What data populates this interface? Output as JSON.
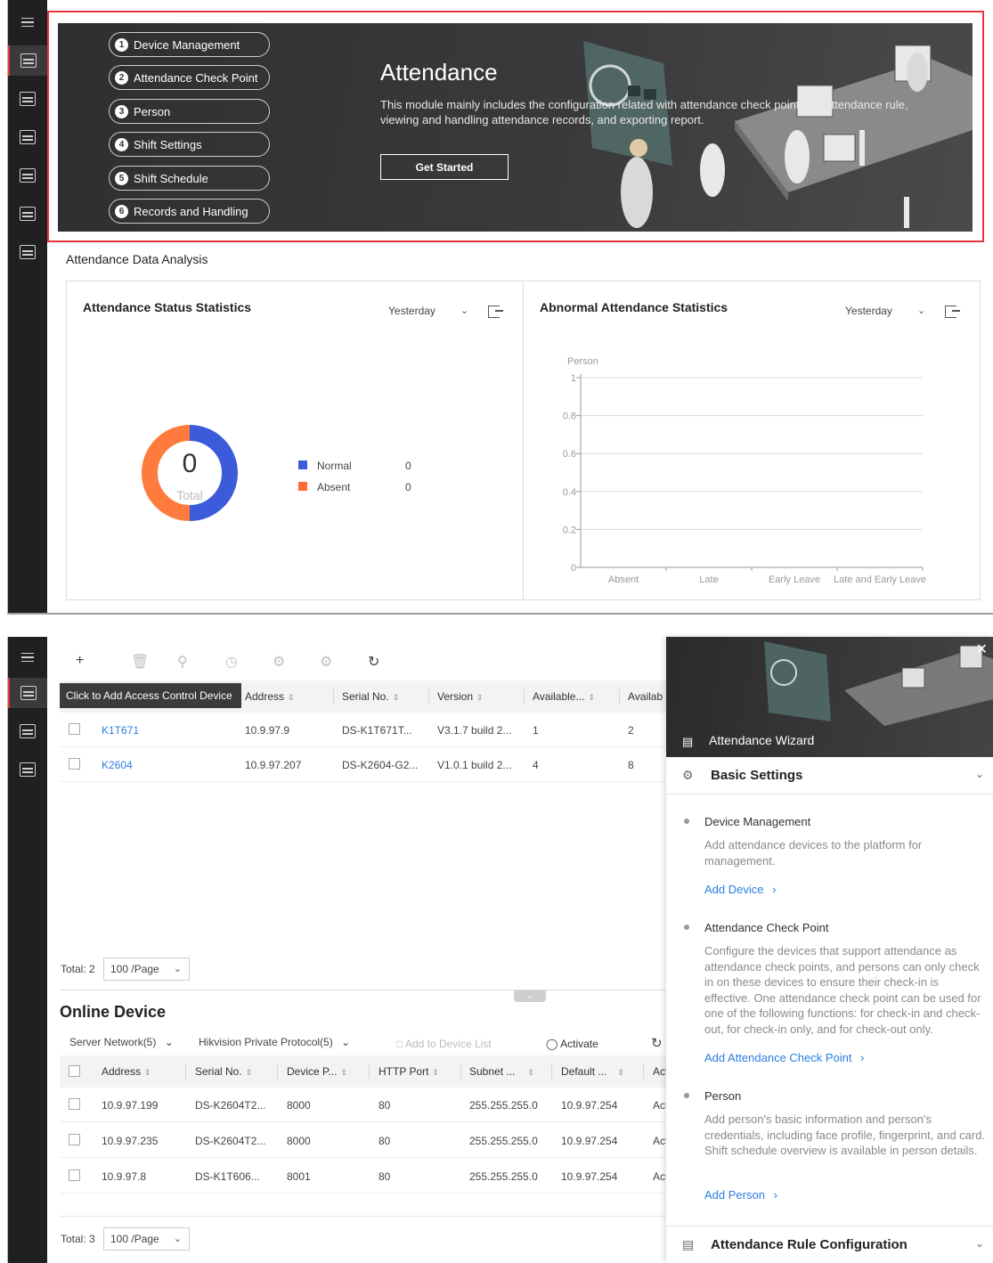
{
  "panel1": {
    "steps": [
      {
        "num": "1",
        "label": "Device Management"
      },
      {
        "num": "2",
        "label": "Attendance Check Point"
      },
      {
        "num": "3",
        "label": "Person"
      },
      {
        "num": "4",
        "label": "Shift Settings"
      },
      {
        "num": "5",
        "label": "Shift Schedule"
      },
      {
        "num": "6",
        "label": "Records and Handling"
      }
    ],
    "banner": {
      "title": "Attendance",
      "description": "This module mainly includes the configuration related with attendance check point and attendance rule, viewing and handling attendance records, and exporting report.",
      "cta": "Get Started"
    },
    "section_title": "Attendance Data Analysis",
    "status_card": {
      "title": "Attendance Status Statistics",
      "period": "Yesterday",
      "total_value": "0",
      "total_label": "Total",
      "legend": [
        {
          "label": "Normal",
          "value": "0",
          "color": "#3b5bdb"
        },
        {
          "label": "Absent",
          "value": "0",
          "color": "#ff6b35"
        }
      ]
    },
    "abnormal_card": {
      "title": "Abnormal Attendance Statistics",
      "period": "Yesterday"
    }
  },
  "chart_data": {
    "type": "bar",
    "title": "Abnormal Attendance Statistics",
    "ylabel": "Person",
    "categories": [
      "Absent",
      "Late",
      "Early Leave",
      "Late and Early Leave"
    ],
    "values": [
      0,
      0,
      0,
      0
    ],
    "ylim": [
      0,
      1
    ],
    "yticks": [
      "0",
      "0.2",
      "0.4",
      "0.6",
      "0.8",
      "1"
    ],
    "grid": true
  },
  "panel2": {
    "tooltip": "Click to Add Access Control Device",
    "device_table": {
      "headers": [
        "Address",
        "Serial No.",
        "Version",
        "Available...",
        "Availab"
      ],
      "rows": [
        {
          "name": "K1T671",
          "address": "10.9.97.9",
          "serial": "DS-K1T671T...",
          "version": "V3.1.7 build 2...",
          "avail1": "1",
          "avail2": "2"
        },
        {
          "name": "K2604",
          "address": "10.9.97.207",
          "serial": "DS-K2604-G2...",
          "version": "V1.0.1 build 2...",
          "avail1": "4",
          "avail2": "8"
        }
      ],
      "total": "Total: 2",
      "page_size": "100 /Page"
    },
    "online": {
      "title": "Online Device",
      "filter_network": "Server Network(5)",
      "filter_protocol": "Hikvision Private Protocol(5)",
      "add_to_list": "Add to Device List",
      "activate": "Activate",
      "headers": [
        "Address",
        "Serial No.",
        "Device P...",
        "HTTP Port",
        "Subnet ...",
        "Default ...",
        "Act"
      ],
      "rows": [
        {
          "address": "10.9.97.199",
          "serial": "DS-K2604T2...",
          "port": "8000",
          "http": "80",
          "subnet": "255.255.255.0",
          "gateway": "10.9.97.254",
          "act": "Act"
        },
        {
          "address": "10.9.97.235",
          "serial": "DS-K2604T2...",
          "port": "8000",
          "http": "80",
          "subnet": "255.255.255.0",
          "gateway": "10.9.97.254",
          "act": "Act"
        },
        {
          "address": "10.9.97.8",
          "serial": "DS-K1T606...",
          "port": "8001",
          "http": "80",
          "subnet": "255.255.255.0",
          "gateway": "10.9.97.254",
          "act": "Act"
        }
      ],
      "total": "Total: 3",
      "page_size": "100 /Page"
    }
  },
  "wizard": {
    "title": "Attendance Wizard",
    "basic_settings": "Basic Settings",
    "items": [
      {
        "title": "Device Management",
        "desc": "Add attendance devices to the platform for management.",
        "link": "Add Device"
      },
      {
        "title": "Attendance Check Point",
        "desc": "Configure the devices that support attendance as attendance check points, and persons can only check in on these devices to ensure their check-in is effective. One attendance check point can be used for one of the following functions: for check-in and check-out, for check-in only, and for check-out only.",
        "link": "Add Attendance Check Point"
      },
      {
        "title": "Person",
        "desc": "Add person's basic information and person's credentials, including face profile, fingerprint, and card. Shift schedule overview is available in person details.",
        "link": "Add Person"
      }
    ],
    "rule_config": "Attendance Rule Configuration"
  }
}
